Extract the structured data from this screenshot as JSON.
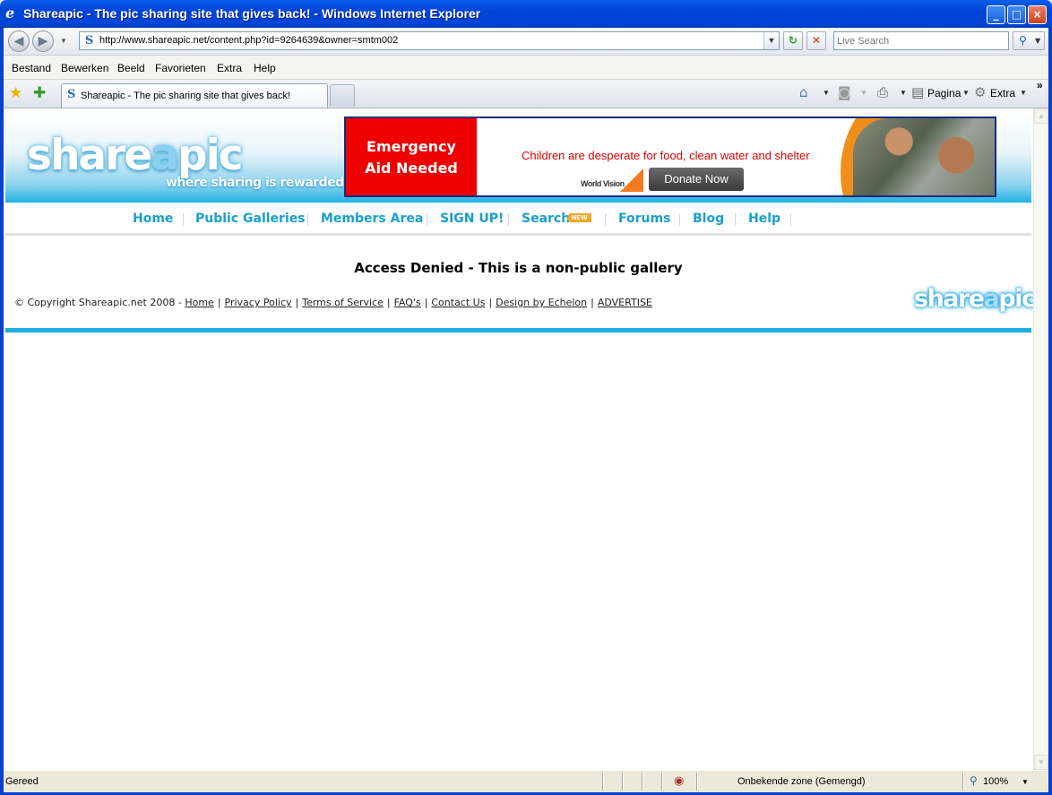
{
  "window": {
    "title": "Shareapic - The pic sharing site that gives back! - Windows Internet Explorer",
    "app_icon": "ie-icon",
    "controls": {
      "minimize": "_",
      "maximize": "□",
      "close": "×"
    }
  },
  "address_bar": {
    "url": "http://www.shareapic.net/content.php?id=9264639&owner=smtm002",
    "search_placeholder": "Live Search",
    "back_glyph": "◀",
    "forward_glyph": "▶",
    "refresh_glyph": "↻",
    "stop_glyph": "✕",
    "search_glyph": "⚲"
  },
  "menu": {
    "items": [
      "Bestand",
      "Bewerken",
      "Beeld",
      "Favorieten",
      "Extra",
      "Help"
    ]
  },
  "tabs": {
    "active_tab_label": "Shareapic - The pic sharing site that gives back!",
    "favicon_glyph": "S"
  },
  "command_bar": {
    "page_label": "Pagina",
    "tools_label": "Extra"
  },
  "site": {
    "logo": {
      "part1": "share",
      "part2": "a",
      "part3": "pic"
    },
    "tagline": "where sharing is rewarded!",
    "ad": {
      "red_line1": "Emergency",
      "red_line2": "Aid Needed",
      "message": "Children are desperate for food, clean water and shelter",
      "brand": "World Vision",
      "cta": "Donate Now"
    },
    "nav": {
      "home": "Home",
      "public_galleries": "Public Galleries",
      "members_area": "Members Area",
      "sign_up": "SIGN UP!",
      "search": "Search",
      "search_badge": "NEW",
      "forums": "Forums",
      "blog": "Blog",
      "help": "Help"
    },
    "message": "Access Denied - This is a non-public gallery",
    "footer": {
      "copyright": "© Copyright Shareapic.net 2008 -",
      "links": {
        "home": "Home",
        "privacy": "Privacy Policy",
        "terms": "Terms of Service",
        "faq": "FAQ's",
        "contact": "Contact Us",
        "design": "Design by Echelon",
        "advertise": "ADVERTISE"
      },
      "logo": {
        "part1": "share",
        "part2": "a",
        "part3": "pic"
      }
    }
  },
  "status_bar": {
    "status": "Gereed",
    "zone": "Onbekende zone (Gemengd)",
    "zoom": "100%"
  }
}
